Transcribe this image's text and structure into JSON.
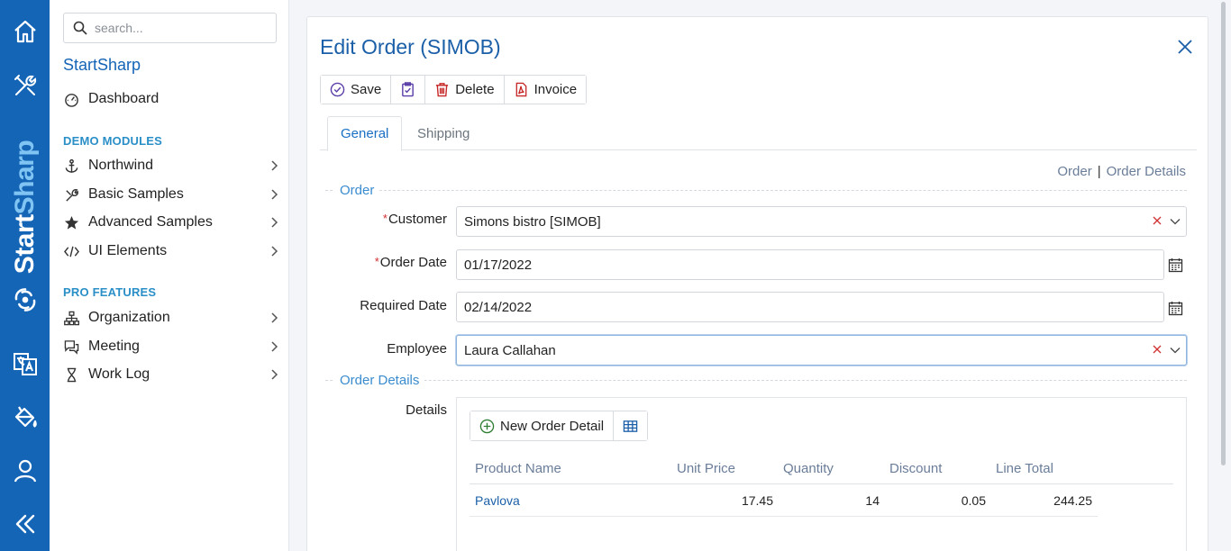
{
  "rail": {
    "brand_part1": "Start",
    "brand_part2": "Sharp",
    "icons": [
      "home-icon",
      "tools-icon",
      "startsharp-logo-icon",
      "translate-icon",
      "paint-bucket-icon",
      "user-icon",
      "collapse-icon"
    ]
  },
  "sidebar": {
    "search_placeholder": "search...",
    "app_title": "StartSharp",
    "dashboard": "Dashboard",
    "sections": [
      {
        "title": "DEMO MODULES",
        "items": [
          "Northwind",
          "Basic Samples",
          "Advanced Samples",
          "UI Elements"
        ]
      },
      {
        "title": "PRO FEATURES",
        "items": [
          "Organization",
          "Meeting",
          "Work Log"
        ]
      }
    ]
  },
  "dialog": {
    "title": "Edit Order (SIMOB)",
    "toolbar": {
      "save": "Save",
      "delete": "Delete",
      "invoice": "Invoice"
    },
    "tabs": [
      "General",
      "Shipping"
    ],
    "crumbs": [
      "Order",
      "Order Details"
    ],
    "categories": {
      "order": "Order",
      "order_details": "Order Details"
    },
    "fields": {
      "customer": {
        "label": "Customer",
        "value": "Simons bistro [SIMOB]",
        "required": "*"
      },
      "order_date": {
        "label": "Order Date",
        "value": "01/17/2022",
        "required": "*"
      },
      "required_date": {
        "label": "Required Date",
        "value": "02/14/2022"
      },
      "employee": {
        "label": "Employee",
        "value": "Laura Callahan"
      }
    },
    "details": {
      "label": "Details",
      "new_button": "New Order Detail",
      "columns": [
        "Product Name",
        "Unit Price",
        "Quantity",
        "Discount",
        "Line Total"
      ],
      "rows": [
        {
          "product": "Pavlova",
          "unit_price": "17.45",
          "quantity": "14",
          "discount": "0.05",
          "line_total": "244.25"
        }
      ]
    }
  },
  "colors": {
    "rail": "#1565b7",
    "accent": "#1a5fa8",
    "section": "#2a8fc7",
    "required": "#d03030"
  }
}
